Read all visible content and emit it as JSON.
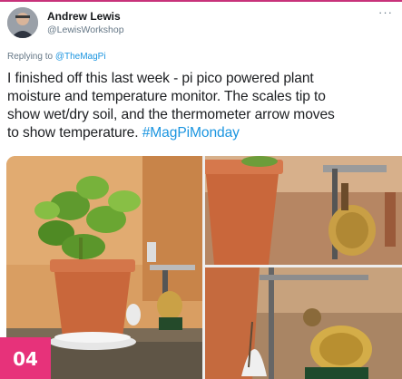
{
  "tweet": {
    "author_name": "Andrew Lewis",
    "author_handle": "@LewisWorkshop",
    "more_label": "···",
    "replying_prefix": "Replying to ",
    "replying_to": "@TheMagPi",
    "text_line1": "I finished off this last week - pi pico powered plant",
    "text_line2": "moisture and temperature monitor. The scales tip to",
    "text_line3": "show wet/dry soil, and the thermometer arrow moves",
    "text_line4_prefix": "to show temperature. ",
    "hashtag": "#MagPiMonday"
  },
  "badge": {
    "label": "04"
  },
  "colors": {
    "accent": "#e7327a",
    "link": "#1b95e0",
    "muted": "#657786"
  },
  "media": {
    "photos": [
      {
        "name": "plant-monitor-photo-main"
      },
      {
        "name": "plant-pot-scales-photo"
      },
      {
        "name": "brass-thermometer-photo"
      }
    ]
  }
}
